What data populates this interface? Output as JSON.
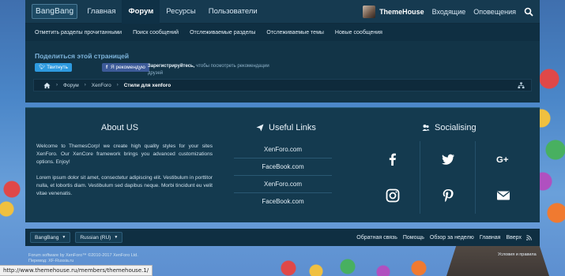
{
  "header": {
    "logo": "BangBang",
    "tabs": [
      {
        "label": "Главная"
      },
      {
        "label": "Форум"
      },
      {
        "label": "Ресурсы"
      },
      {
        "label": "Пользователи"
      }
    ],
    "user": "ThemeHouse",
    "login": "Входящие",
    "alerts": "Оповещения"
  },
  "subnav": {
    "items": [
      "Отметить разделы прочитанными",
      "Поиск сообщений",
      "Отслеживаемые разделы",
      "Отслеживаемые темы",
      "Новые сообщения"
    ]
  },
  "share": {
    "title": "Поделиться этой страницей",
    "tweet": "Твитнуть",
    "like": "Я рекомендую",
    "register_bold": "Зарегистрируйтесь,",
    "register_rest": " чтобы посмотреть рекомендации друзей"
  },
  "breadcrumb": {
    "items": [
      "Форум",
      "XenForo",
      "Стили для xenforo"
    ]
  },
  "about": {
    "title": "About US",
    "p1": "Welcome to ThemesCorp! we create high quality styles for your sites XenForo. Our XenCore framework brings you advanced customizations options. Enjoy!",
    "p2": "Lorem ipsum dolor sit amet, consectetur adipiscing elit. Vestibulum in porttitor nulla, et lobortis diam. Vestibulum sed dapibus neque. Morbi tincidunt eu velit vitae venenatis."
  },
  "useful_links": {
    "title": "Useful Links",
    "items": [
      "XenForo.com",
      "FaceBook.com",
      "XenForo.com",
      "FaceBook.com"
    ]
  },
  "socialising": {
    "title": "Socialising",
    "icons": [
      "facebook-icon",
      "twitter-icon",
      "google-plus-icon",
      "instagram-icon",
      "pinterest-icon",
      "email-icon"
    ]
  },
  "footer": {
    "style_select": "BangBang",
    "language_select": "Russian (RU)",
    "links": [
      "Обратная связь",
      "Помощь",
      "Обзор за неделю",
      "Главная",
      "Вверх"
    ],
    "copyright_line1": "Forum software by XenForo™ ©2010-2017 XenForo Ltd.",
    "copyright_line2": "Перевод: XF-Russia.ru",
    "terms": "Условия и правила"
  },
  "status_url": "http://www.themehouse.ru/members/themehouse.1/",
  "colors": {
    "nav_bg": "#163a50",
    "panel_bg": "#143a4f",
    "accent": "#7fb6de",
    "tweet": "#2d9ae0",
    "facebook": "#3c5a98"
  }
}
